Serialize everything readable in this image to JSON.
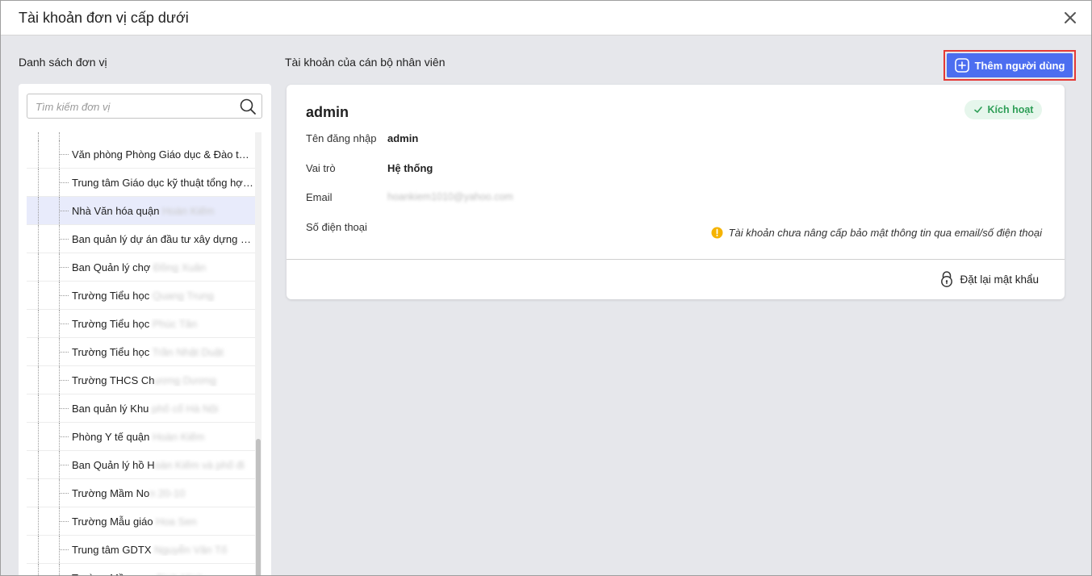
{
  "dialog": {
    "title": "Tài khoản đơn vị cấp dưới"
  },
  "left_panel": {
    "title": "Danh sách đơn vị",
    "search_placeholder": "Tìm kiếm đơn vị",
    "items": [
      {
        "label": "Văn phòng Phòng Giáo dục & Đào tạo...",
        "hidden": "",
        "selected": false
      },
      {
        "label": "Trung tâm Giáo dục kỹ thuật tổng hợp...",
        "hidden": "",
        "selected": false
      },
      {
        "label": "Nhà Văn hóa quận ",
        "hidden": "Hoàn Kiếm",
        "selected": true
      },
      {
        "label": "Ban quản lý dự án đầu tư xây dựng qu...",
        "hidden": "",
        "selected": false
      },
      {
        "label": "Ban Quản lý chợ ",
        "hidden": "Đồng Xuân",
        "selected": false
      },
      {
        "label": "Trường Tiểu học ",
        "hidden": "Quang Trung",
        "selected": false
      },
      {
        "label": "Trường Tiểu học ",
        "hidden": "Phúc Tân",
        "selected": false
      },
      {
        "label": "Trường Tiểu học ",
        "hidden": "Trần Nhật Duật",
        "selected": false
      },
      {
        "label": "Trường THCS Ch",
        "hidden": "ương Dương",
        "selected": false
      },
      {
        "label": "Ban quản lý Khu ",
        "hidden": "phố cổ Hà Nội",
        "selected": false
      },
      {
        "label": "Phòng Y tế quận ",
        "hidden": "Hoàn Kiếm",
        "selected": false
      },
      {
        "label": "Ban Quản lý hồ H",
        "hidden": "oàn Kiếm và phố đi",
        "selected": false
      },
      {
        "label": "Trường Mầm No",
        "hidden": "n 20-10",
        "selected": false
      },
      {
        "label": "Trường Mẫu giáo ",
        "hidden": "Hoa Sen",
        "selected": false
      },
      {
        "label": "Trung tâm GDTX ",
        "hidden": "Nguyễn Văn Tố",
        "selected": false
      },
      {
        "label": "Trường Mầm non ",
        "hidden": "Bình Minh",
        "selected": false
      }
    ]
  },
  "right_panel": {
    "title": "Tài khoản của cán bộ nhân viên",
    "add_user_label": "Thêm người dùng",
    "account": {
      "name": "admin",
      "status": "Kích hoạt",
      "username_label": "Tên đăng nhập",
      "username": "admin",
      "role_label": "Vai trò",
      "role": "Hệ thống",
      "email_label": "Email",
      "email": "hoankiem1010@yahoo.com",
      "phone_label": "Số điện thoại",
      "phone": "",
      "warning": "Tài khoản chưa nâng cấp bảo mật thông tin qua email/số điện thoại",
      "reset_password_label": "Đặt lại mật khẩu"
    }
  },
  "colors": {
    "primary": "#4c6ef0",
    "highlight_border": "#e53935",
    "active_badge_bg": "#e6f6ec",
    "active_badge_text": "#2e9e57",
    "warning": "#f5b301",
    "selected_row": "#e8ebfb"
  }
}
